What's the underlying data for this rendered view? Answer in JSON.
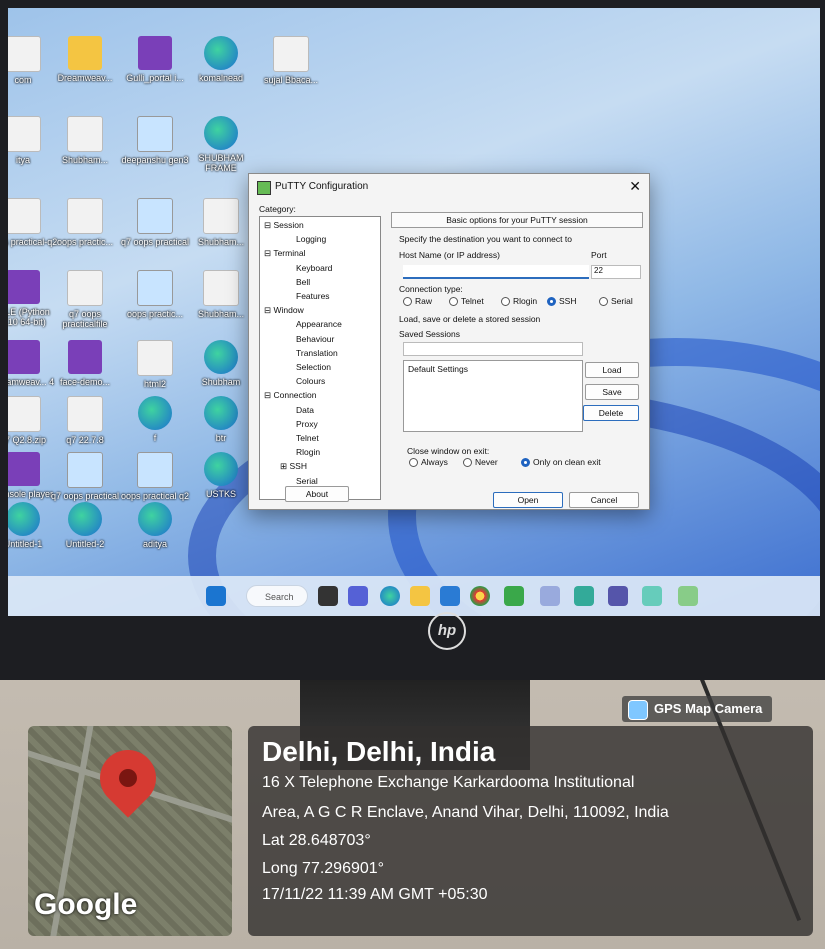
{
  "desktop_icons": [
    {
      "label": "com",
      "kind": "doc"
    },
    {
      "label": "Dreamweav...",
      "kind": "folder"
    },
    {
      "label": "Gulli_portal i...",
      "kind": "app"
    },
    {
      "label": "komalnead",
      "kind": "edge"
    },
    {
      "label": "sujal Bbaca...",
      "kind": "doc"
    },
    {
      "label": "itya",
      "kind": "doc"
    },
    {
      "label": "Shubham...",
      "kind": "doc"
    },
    {
      "label": "deepanshu gen3",
      "kind": "img"
    },
    {
      "label": "SHUBHAM FRAME",
      "kind": "edge"
    },
    {
      "label": "oops practical-q2",
      "kind": "doc"
    },
    {
      "label": "oops practic...",
      "kind": "doc"
    },
    {
      "label": "q7 oops practical",
      "kind": "img"
    },
    {
      "label": "Shubham...",
      "kind": "doc"
    },
    {
      "label": "IDLE (Python 3.10 64-bit)",
      "kind": "app"
    },
    {
      "label": "q7 oops practicalfile",
      "kind": "doc"
    },
    {
      "label": "oops practic...",
      "kind": "img"
    },
    {
      "label": "Shubham...",
      "kind": "doc"
    },
    {
      "label": "Dreamweav... 4",
      "kind": "app"
    },
    {
      "label": "face-demo...",
      "kind": "app"
    },
    {
      "label": "html2",
      "kind": "doc"
    },
    {
      "label": "Shubham",
      "kind": "edge"
    },
    {
      "label": "q7 Q2.8.zip",
      "kind": "doc"
    },
    {
      "label": "q7 22.7.8",
      "kind": "doc"
    },
    {
      "label": "f",
      "kind": "edge"
    },
    {
      "label": "btr",
      "kind": "edge"
    },
    {
      "label": "Console player",
      "kind": "app"
    },
    {
      "label": "q7 oops practical",
      "kind": "img"
    },
    {
      "label": "oops practical q2",
      "kind": "img"
    },
    {
      "label": "USTKS",
      "kind": "edge"
    },
    {
      "label": "frame2",
      "kind": "edge"
    },
    {
      "label": "Untitled-1",
      "kind": "edge"
    },
    {
      "label": "Untitled-2",
      "kind": "edge"
    },
    {
      "label": "aditya",
      "kind": "edge"
    }
  ],
  "taskbar": {
    "search_placeholder": "Search"
  },
  "monitor": {
    "brand": "hp"
  },
  "putty": {
    "title": "PuTTY Configuration",
    "close_glyph": "✕",
    "category_label": "Category:",
    "tree": [
      {
        "label": "⊟ Session",
        "level": 0
      },
      {
        "label": "Logging",
        "level": 2
      },
      {
        "label": "⊟ Terminal",
        "level": 0
      },
      {
        "label": "Keyboard",
        "level": 2
      },
      {
        "label": "Bell",
        "level": 2
      },
      {
        "label": "Features",
        "level": 2
      },
      {
        "label": "⊟ Window",
        "level": 0
      },
      {
        "label": "Appearance",
        "level": 2
      },
      {
        "label": "Behaviour",
        "level": 2
      },
      {
        "label": "Translation",
        "level": 2
      },
      {
        "label": "Selection",
        "level": 2
      },
      {
        "label": "Colours",
        "level": 2
      },
      {
        "label": "⊟ Connection",
        "level": 0
      },
      {
        "label": "Data",
        "level": 2
      },
      {
        "label": "Proxy",
        "level": 2
      },
      {
        "label": "Telnet",
        "level": 2
      },
      {
        "label": "Rlogin",
        "level": 2
      },
      {
        "label": "⊞ SSH",
        "level": 1
      },
      {
        "label": "Serial",
        "level": 2
      }
    ],
    "panel_header": "Basic options for your PuTTY session",
    "destination_label": "Specify the destination you want to connect to",
    "host_label": "Host Name (or IP address)",
    "port_label": "Port",
    "host_value": "",
    "port_value": "22",
    "conn_type_label": "Connection type:",
    "conn_types": [
      {
        "label": "Raw",
        "selected": false
      },
      {
        "label": "Telnet",
        "selected": false
      },
      {
        "label": "Rlogin",
        "selected": false
      },
      {
        "label": "SSH",
        "selected": true
      },
      {
        "label": "Serial",
        "selected": false
      }
    ],
    "load_save_label": "Load, save or delete a stored session",
    "saved_sessions_label": "Saved Sessions",
    "saved_sessions_value": "",
    "sessions": [
      "Default Settings"
    ],
    "load_btn": "Load",
    "save_btn": "Save",
    "delete_btn": "Delete",
    "close_exit_label": "Close window on exit:",
    "exit_opts": [
      {
        "label": "Always",
        "selected": false
      },
      {
        "label": "Never",
        "selected": false
      },
      {
        "label": "Only on clean exit",
        "selected": true
      }
    ],
    "about_btn": "About",
    "open_btn": "Open",
    "cancel_btn": "Cancel"
  },
  "gps": {
    "badge": "GPS Map Camera",
    "google": "Google",
    "title": "Delhi, Delhi, India",
    "address_line1": "16 X Telephone Exchange Karkardooma Institutional",
    "address_line2": "Area, A G C R Enclave, Anand Vihar, Delhi, 110092, India",
    "lat": "Lat 28.648703°",
    "long": "Long 77.296901°",
    "datetime": "17/11/22 11:39 AM GMT +05:30"
  }
}
